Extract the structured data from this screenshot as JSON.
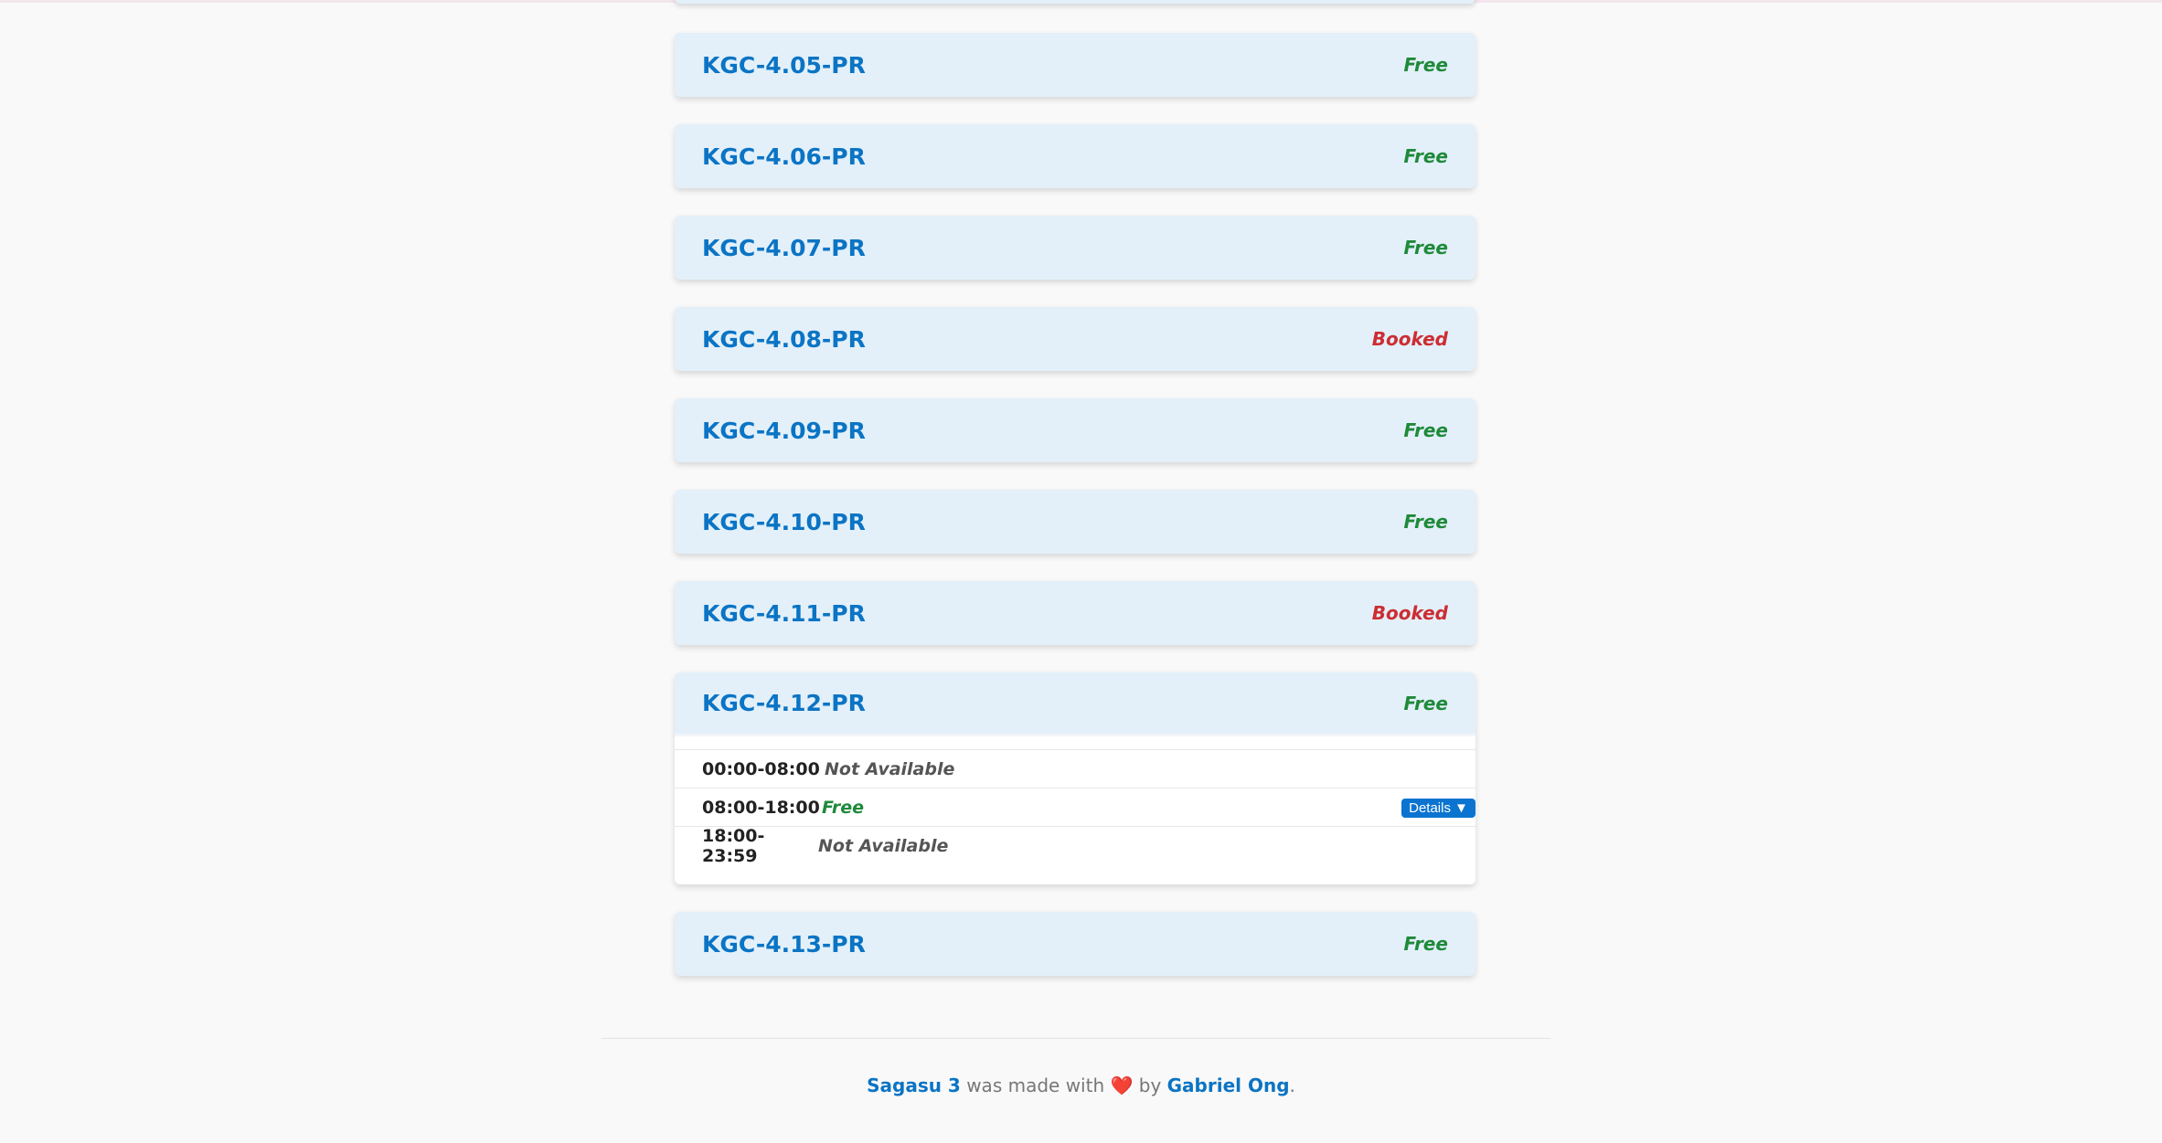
{
  "rooms": [
    {
      "name": "KGC-4.05-PR",
      "status": "Free"
    },
    {
      "name": "KGC-4.06-PR",
      "status": "Free"
    },
    {
      "name": "KGC-4.07-PR",
      "status": "Free"
    },
    {
      "name": "KGC-4.08-PR",
      "status": "Booked"
    },
    {
      "name": "KGC-4.09-PR",
      "status": "Free"
    },
    {
      "name": "KGC-4.10-PR",
      "status": "Free"
    },
    {
      "name": "KGC-4.11-PR",
      "status": "Booked"
    },
    {
      "name": "KGC-4.12-PR",
      "status": "Free",
      "slots": [
        {
          "time": "00:00-08:00",
          "status": "Not Available"
        },
        {
          "time": "08:00-18:00",
          "status": "Free",
          "details_label": "Details ▼"
        },
        {
          "time": "18:00-23:59",
          "status": "Not Available"
        }
      ]
    },
    {
      "name": "KGC-4.13-PR",
      "status": "Free"
    }
  ],
  "footer": {
    "app_link": "Sagasu 3",
    "made_with": "was made with",
    "heart": "❤️",
    "by": "by",
    "author_link": "Gabriel Ong",
    "period": "."
  },
  "colors": {
    "link": "#0b74c4",
    "free": "#1f8a3a",
    "booked": "#cc2d33",
    "card_bg": "#e3f0fa"
  }
}
